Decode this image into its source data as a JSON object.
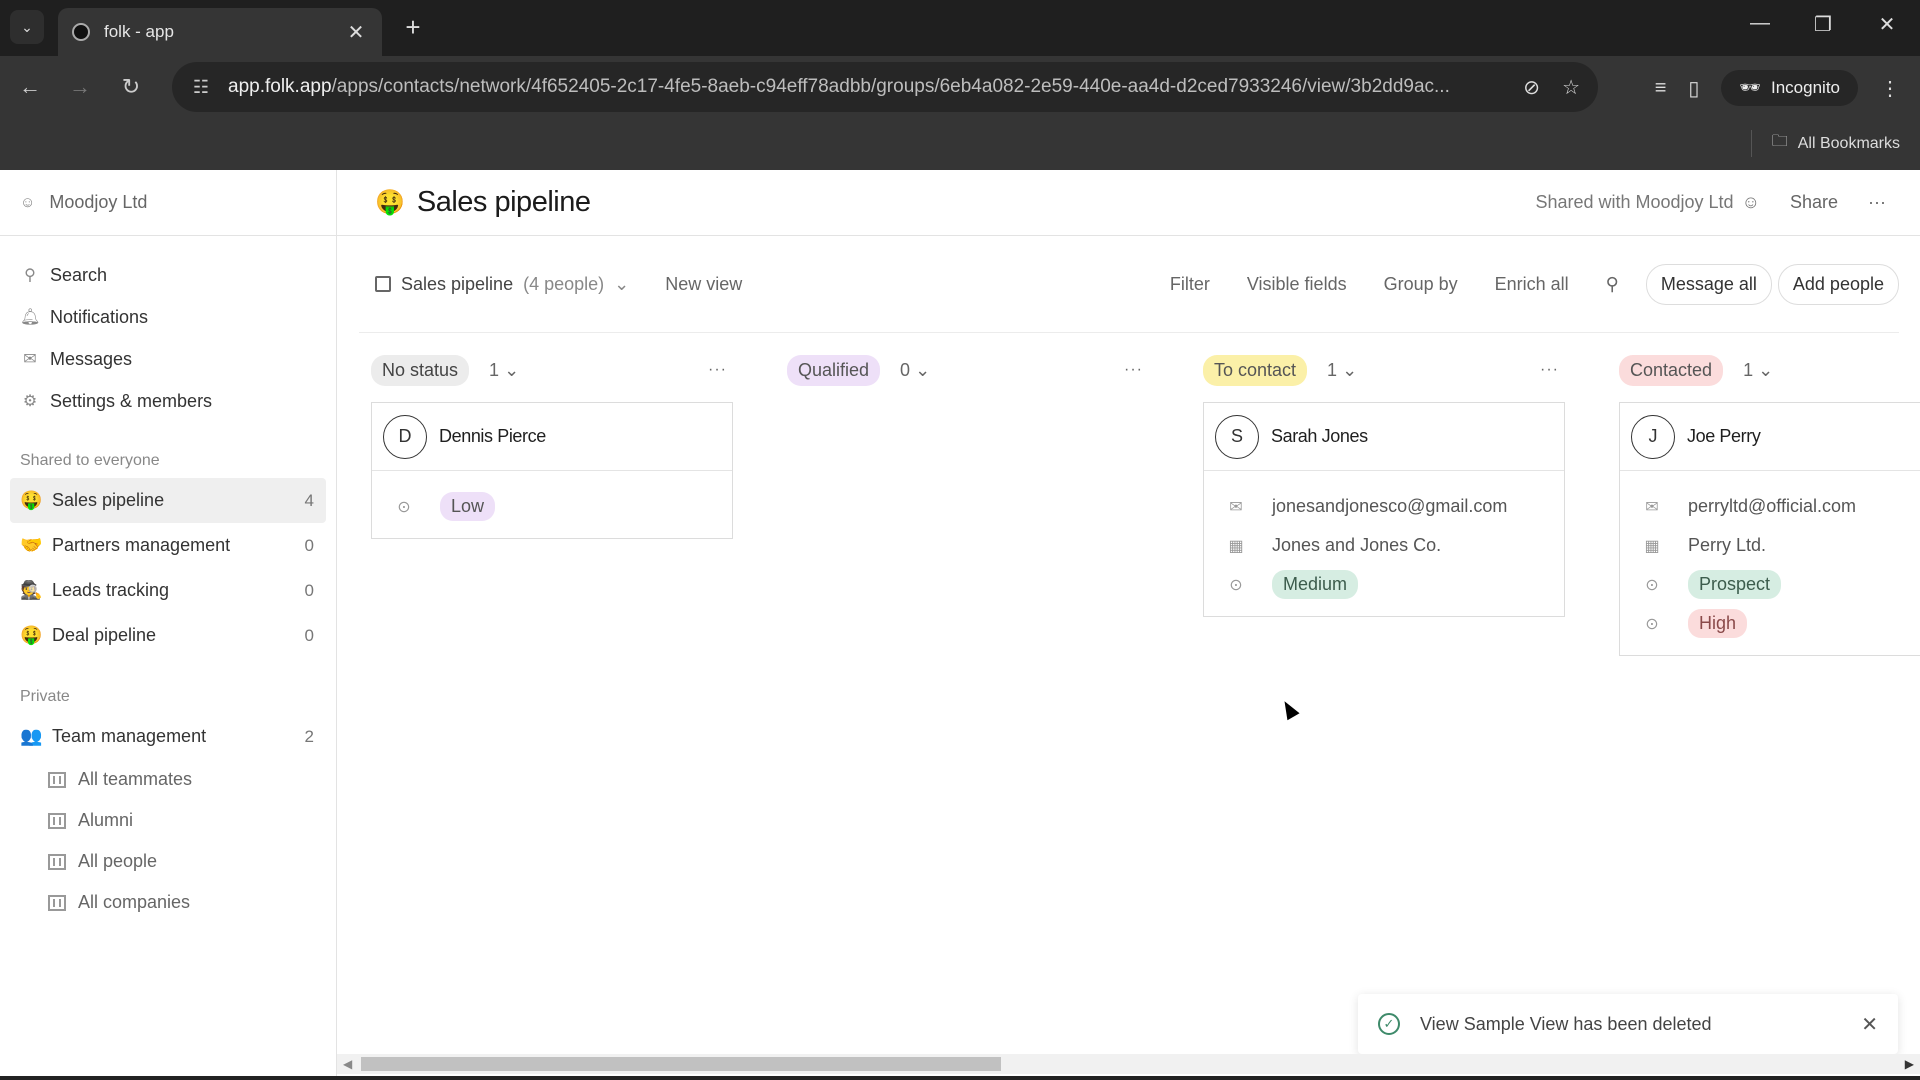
{
  "browser": {
    "tab_title": "folk - app",
    "url_host": "app.folk.app",
    "url_path": "/apps/contacts/network/4f652405-2c17-4fe5-8aeb-c94eff78adbb/groups/6eb4a082-2e59-440e-aa4d-d2ced7933246/view/3b2dd9ac...",
    "incognito_label": "Incognito",
    "bookmarks_label": "All Bookmarks"
  },
  "sidebar": {
    "workspace": "Moodjoy Ltd",
    "nav": [
      {
        "label": "Search",
        "icon": "search-icon"
      },
      {
        "label": "Notifications",
        "icon": "bell-icon"
      },
      {
        "label": "Messages",
        "icon": "mail-icon"
      },
      {
        "label": "Settings & members",
        "icon": "gear-icon"
      }
    ],
    "shared_label": "Shared to everyone",
    "shared_groups": [
      {
        "emoji": "🤑",
        "label": "Sales pipeline",
        "count": "4",
        "active": true
      },
      {
        "emoji": "🤝",
        "label": "Partners management",
        "count": "0"
      },
      {
        "emoji": "🕵",
        "label": "Leads tracking",
        "count": "0"
      },
      {
        "emoji": "🤑",
        "label": "Deal pipeline",
        "count": "0"
      }
    ],
    "private_label": "Private",
    "private_group": {
      "emoji": "👥",
      "label": "Team management",
      "count": "2"
    },
    "private_views": [
      "All teammates",
      "Alumni",
      "All people",
      "All companies"
    ]
  },
  "header": {
    "emoji": "🤑",
    "title": "Sales pipeline",
    "shared_with": "Shared with Moodjoy Ltd",
    "share_label": "Share",
    "more_label": "···"
  },
  "viewbar": {
    "view_name": "Sales pipeline",
    "view_count": "(4 people)",
    "new_view": "New view",
    "filter": "Filter",
    "visible_fields": "Visible fields",
    "group_by": "Group by",
    "enrich_all": "Enrich all",
    "message_all": "Message all",
    "add_people": "Add people"
  },
  "columns": [
    {
      "status": "No status",
      "count": "1",
      "bg": "#ececec",
      "fg": "#444",
      "cards": [
        {
          "initial": "D",
          "name": "Dennis Pierce",
          "fields": [],
          "tags": [
            {
              "label": "Low",
              "bg": "#eee0f8",
              "fg": "#555"
            }
          ]
        }
      ]
    },
    {
      "status": "Qualified",
      "count": "0",
      "bg": "#eee0f8",
      "fg": "#555",
      "cards": []
    },
    {
      "status": "To contact",
      "count": "1",
      "bg": "#fbf0a8",
      "fg": "#555",
      "cards": [
        {
          "initial": "S",
          "name": "Sarah Jones",
          "fields": [
            {
              "icon": "mail-icon",
              "value": "jonesandjonesco@gmail.com"
            },
            {
              "icon": "company-icon",
              "value": "Jones and Jones Co."
            }
          ],
          "tags": [
            {
              "label": "Medium",
              "bg": "#d6ede2",
              "fg": "#3c5c4c"
            }
          ]
        }
      ]
    },
    {
      "status": "Contacted",
      "count": "1",
      "bg": "#fbdcdc",
      "fg": "#555",
      "cards": [
        {
          "initial": "J",
          "name": "Joe Perry",
          "fields": [
            {
              "icon": "mail-icon",
              "value": "perryltd@official.com"
            },
            {
              "icon": "company-icon",
              "value": "Perry Ltd."
            }
          ],
          "tags": [
            {
              "label": "Prospect",
              "bg": "#d6ede2",
              "fg": "#3c5c4c"
            },
            {
              "label": "High",
              "bg": "#fbdcdc",
              "fg": "#8a4a4a"
            }
          ]
        }
      ]
    }
  ],
  "toast": {
    "message": "View Sample View has been deleted"
  }
}
